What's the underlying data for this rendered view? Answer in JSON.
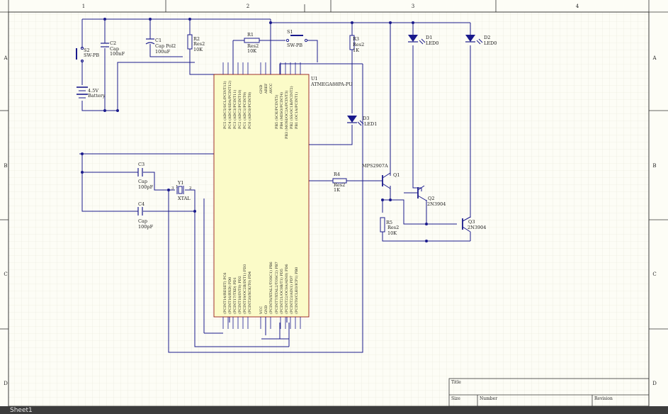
{
  "sheet": {
    "columns": [
      "1",
      "2",
      "3",
      "4"
    ],
    "rows": [
      "A",
      "B",
      "C",
      "D"
    ],
    "tab_label": "Sheet1"
  },
  "title_block": {
    "title_label": "Title",
    "size_label": "Size",
    "number_label": "Number",
    "revision_label": "Revision"
  },
  "components": {
    "s2": {
      "ref": "S2",
      "value": "SW-PB"
    },
    "c2": {
      "ref": "C2",
      "type": "Cap",
      "value": "100nF"
    },
    "c1": {
      "ref": "C1",
      "type": "Cap Pol2",
      "value": "100uF"
    },
    "r2": {
      "ref": "R2",
      "type": "Res2",
      "value": "10K"
    },
    "r1": {
      "ref": "R1",
      "type": "Res2",
      "value": "10K"
    },
    "s1": {
      "ref": "S1",
      "value": "SW-PB"
    },
    "r3": {
      "ref": "R3",
      "type": "Res2",
      "value": "1K"
    },
    "d1": {
      "ref": "D1",
      "value": "LED0"
    },
    "d2": {
      "ref": "D2",
      "value": "LED0"
    },
    "d3": {
      "ref": "D3",
      "value": "LED1"
    },
    "battery": {
      "value": "4.5V",
      "type": "Battery"
    },
    "c3": {
      "ref": "C3",
      "type": "Cap",
      "value": "100pF"
    },
    "c4": {
      "ref": "C4",
      "type": "Cap",
      "value": "100pF"
    },
    "y1": {
      "ref": "Y1",
      "value": "XTAL",
      "pin1": "1",
      "pin2": "2",
      "pin3": "3"
    },
    "r4": {
      "ref": "R4",
      "type": "Res2",
      "value": "1K"
    },
    "r5": {
      "ref": "R5",
      "type": "Res2",
      "value": "10K"
    },
    "q1": {
      "ref": "Q1",
      "value": "MPS2907A"
    },
    "q2": {
      "ref": "Q2",
      "value": "2N3904"
    },
    "q3": {
      "ref": "Q3",
      "value": "2N3904"
    },
    "u1": {
      "ref": "U1",
      "value": "ATMEGA88PA-PU"
    }
  },
  "u1_pins_top": [
    "PC5 (ADC5/SCL/PCINT13)",
    "PC4 (ADC4/SDA/PCINT12)",
    "PC3 (ADC3/PCINT11)",
    "PC2 (ADC2/PCINT10)",
    "PC1 (ADC1/PCINT9)",
    "PC0 (ADC0/PCINT8)",
    "GND",
    "AREF",
    "AVCC",
    "PB5 (SCK/PCINT5)",
    "PB4 (MISO/PCINT4)",
    "PB3 (MOSI/OC2A/PCINT3)",
    "PB2 (SS/OC1B/PCINT2)",
    "PB1 (OC1A/PCINT1)"
  ],
  "u1_pins_bottom": [
    "(PCINT14/RESET) PC6",
    "(PCINT16/RXD) PD0",
    "(PCINT17/TXD) PD1",
    "(PCINT18/INT0) PD2",
    "(PCINT19/OC2B/INT1) PD3",
    "(PCINT20/XCK/T0) PD4",
    "VCC",
    "GND",
    "(PCINT6/XTAL1/TOSC1) PB6",
    "(PCINT7/XTAL2/TOSC2) PB7",
    "(PCINT21/OC0B/T1) PD5",
    "(PCINT22/OC0A/AIN0) PD6",
    "(PCINT23/AIN1) PD7",
    "(PCINT0/CLKO/ICP1) PB0"
  ]
}
